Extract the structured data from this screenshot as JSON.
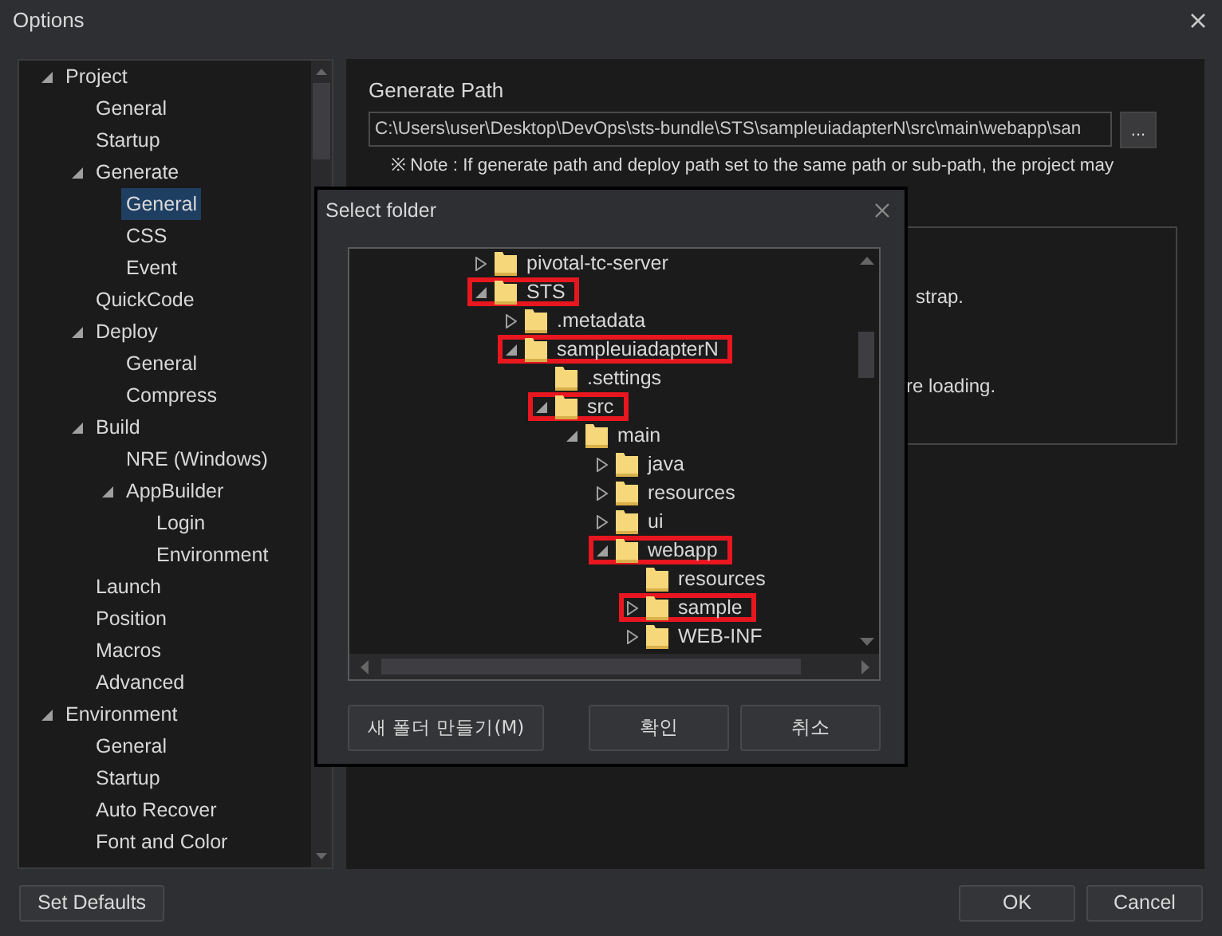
{
  "window": {
    "title": "Options"
  },
  "sidebar": {
    "items": [
      {
        "label": "Project",
        "selected": false,
        "expanded": true,
        "children": [
          {
            "label": "General",
            "selected": false
          },
          {
            "label": "Startup",
            "selected": false
          },
          {
            "label": "Generate",
            "selected": false,
            "expanded": true,
            "children": [
              {
                "label": "General",
                "selected": true
              },
              {
                "label": "CSS",
                "selected": false
              },
              {
                "label": "Event",
                "selected": false
              }
            ]
          },
          {
            "label": "QuickCode",
            "selected": false
          },
          {
            "label": "Deploy",
            "selected": false,
            "expanded": true,
            "children": [
              {
                "label": "General",
                "selected": false
              },
              {
                "label": "Compress",
                "selected": false
              }
            ]
          },
          {
            "label": "Build",
            "selected": false,
            "expanded": true,
            "children": [
              {
                "label": "NRE (Windows)",
                "selected": false
              },
              {
                "label": "AppBuilder",
                "selected": false,
                "expanded": true,
                "children": [
                  {
                    "label": "Login",
                    "selected": false
                  },
                  {
                    "label": "Environment",
                    "selected": false
                  }
                ]
              }
            ]
          },
          {
            "label": "Launch",
            "selected": false
          },
          {
            "label": "Position",
            "selected": false
          },
          {
            "label": "Macros",
            "selected": false
          },
          {
            "label": "Advanced",
            "selected": false
          }
        ]
      },
      {
        "label": "Environment",
        "selected": false,
        "expanded": true,
        "children": [
          {
            "label": "General",
            "selected": false
          },
          {
            "label": "Startup",
            "selected": false
          },
          {
            "label": "Auto Recover",
            "selected": false
          },
          {
            "label": "Font and Color",
            "selected": false
          }
        ]
      }
    ]
  },
  "panel": {
    "generate_path": {
      "label": "Generate Path",
      "value": "C:\\Users\\user\\Desktop\\DevOps\\sts-bundle\\STS\\sampleuiadapterN\\src\\main\\webapp\\san",
      "browse_button": "..."
    },
    "note": "※ Note : If generate path and deploy path set to the same path or sub-path, the project may",
    "group_box": {
      "lines": [
        "strap.",
        "re loading."
      ]
    }
  },
  "dialog": {
    "title": "Select folder",
    "folders": [
      {
        "label": "pivotal-tc-server",
        "expandable": true,
        "expanded": false,
        "highlighted": false
      },
      {
        "label": "STS",
        "expandable": true,
        "expanded": true,
        "highlighted": true,
        "children": [
          {
            "label": ".metadata",
            "expandable": true,
            "expanded": false,
            "highlighted": false
          },
          {
            "label": "sampleuiadapterN",
            "expandable": true,
            "expanded": true,
            "highlighted": true,
            "children": [
              {
                "label": ".settings",
                "expandable": false,
                "highlighted": false
              },
              {
                "label": "src",
                "expandable": true,
                "expanded": true,
                "highlighted": true,
                "children": [
                  {
                    "label": "main",
                    "expandable": true,
                    "expanded": true,
                    "highlighted": false,
                    "children": [
                      {
                        "label": "java",
                        "expandable": true,
                        "expanded": false,
                        "highlighted": false
                      },
                      {
                        "label": "resources",
                        "expandable": true,
                        "expanded": false,
                        "highlighted": false
                      },
                      {
                        "label": "ui",
                        "expandable": true,
                        "expanded": false,
                        "highlighted": false
                      },
                      {
                        "label": "webapp",
                        "expandable": true,
                        "expanded": true,
                        "highlighted": true,
                        "children": [
                          {
                            "label": "resources",
                            "expandable": false,
                            "highlighted": false
                          },
                          {
                            "label": "sample",
                            "expandable": true,
                            "expanded": false,
                            "highlighted": true
                          },
                          {
                            "label": "WEB-INF",
                            "expandable": true,
                            "expanded": false,
                            "highlighted": false
                          }
                        ]
                      }
                    ]
                  }
                ]
              }
            ]
          }
        ]
      }
    ],
    "buttons": {
      "new_folder": "새 폴더 만들기(M)",
      "confirm": "확인",
      "cancel": "취소"
    }
  },
  "buttons": {
    "set_defaults": "Set Defaults",
    "ok": "OK",
    "cancel": "Cancel"
  }
}
